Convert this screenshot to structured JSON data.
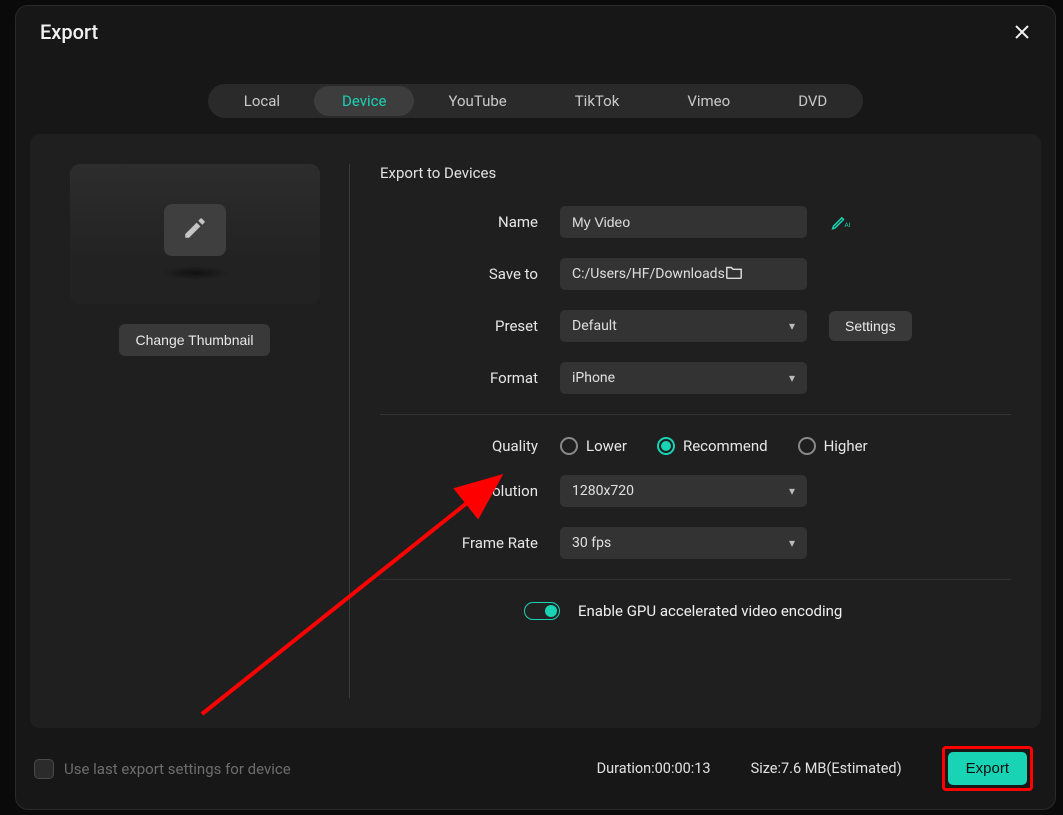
{
  "dialog": {
    "title": "Export"
  },
  "tabs": {
    "local": "Local",
    "device": "Device",
    "youtube": "YouTube",
    "tiktok": "TikTok",
    "vimeo": "Vimeo",
    "dvd": "DVD",
    "active": "device"
  },
  "thumbnail": {
    "change_label": "Change Thumbnail"
  },
  "section": {
    "title": "Export to Devices"
  },
  "fields": {
    "name_label": "Name",
    "name_value": "My Video",
    "save_to_label": "Save to",
    "save_to_value": "C:/Users/HF/Downloads",
    "preset_label": "Preset",
    "preset_value": "Default",
    "settings_btn": "Settings",
    "format_label": "Format",
    "format_value": "iPhone",
    "quality_label": "Quality",
    "quality_options": {
      "lower": "Lower",
      "recommend": "Recommend",
      "higher": "Higher",
      "selected": "recommend"
    },
    "resolution_label": "Resolution",
    "resolution_value": "1280x720",
    "framerate_label": "Frame Rate",
    "framerate_value": "30 fps"
  },
  "gpu": {
    "label": "Enable GPU accelerated video encoding",
    "enabled": true
  },
  "footer": {
    "remember_label": "Use last export settings for device",
    "duration_label": "Duration:",
    "duration_value": "00:00:13",
    "size_label": "Size:",
    "size_value": "7.6 MB(Estimated)",
    "export_btn": "Export"
  },
  "colors": {
    "accent": "#19d3b5",
    "annotation": "#ff0000"
  }
}
